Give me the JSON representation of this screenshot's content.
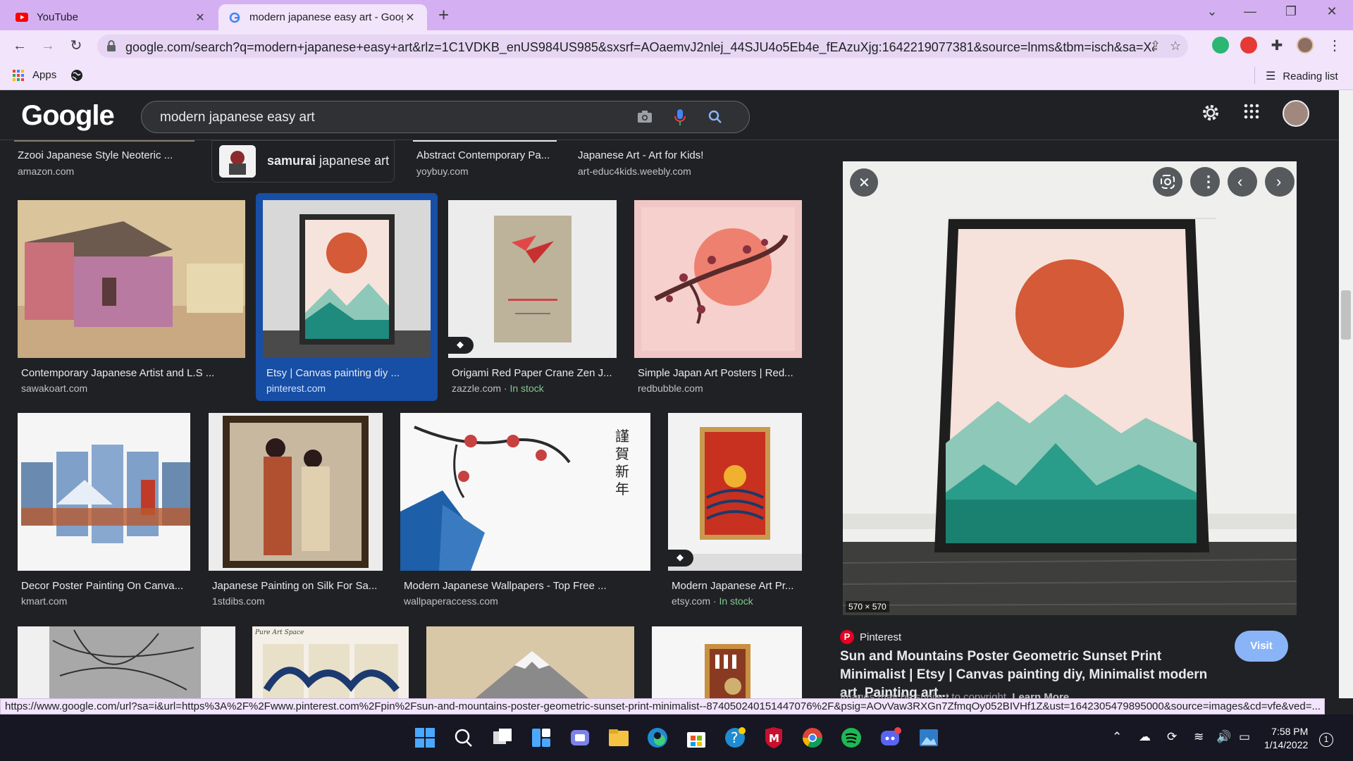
{
  "browser": {
    "tabs": [
      {
        "title": "YouTube",
        "icon": "youtube-icon"
      },
      {
        "title": "modern japanese easy art - Goog",
        "icon": "google-icon"
      }
    ],
    "url": "google.com/search?q=modern+japanese+easy+art&rlz=1C1VDKB_enUS984US985&sxsrf=AOaemvJ2nlej_44SJU4o5Eb4e_fEAzuXjg:1642219077381&source=lnms&tbm=isch&sa=X&ved...",
    "bookmarks": {
      "apps": "Apps",
      "reading_list": "Reading list"
    }
  },
  "google": {
    "logo": "Google",
    "query": "modern japanese easy art"
  },
  "results": {
    "row0": [
      {
        "caption": "Zzooi Japanese Style Neoteric ...",
        "domain": "amazon.com"
      },
      {
        "caption_bold": "samurai",
        "caption_rest": " japanese art"
      },
      {
        "caption": "Abstract Contemporary Pa...",
        "domain": "yoybuy.com"
      },
      {
        "caption": "Japanese Art - Art for Kids!",
        "domain": "art-educ4kids.weebly.com"
      }
    ],
    "row1": [
      {
        "caption": "Contemporary Japanese Artist and L.S ...",
        "domain": "sawakoart.com"
      },
      {
        "caption": "Etsy | Canvas painting diy ...",
        "domain": "pinterest.com"
      },
      {
        "caption": "Origami Red Paper Crane Zen J...",
        "domain": "zazzle.com",
        "stock": "In stock"
      },
      {
        "caption": "Simple Japan Art Posters | Red...",
        "domain": "redbubble.com"
      }
    ],
    "row2": [
      {
        "caption": "Decor Poster Painting On Canva...",
        "domain": "kmart.com"
      },
      {
        "caption": "Japanese Painting on Silk For Sa...",
        "domain": "1stdibs.com"
      },
      {
        "caption": "Modern Japanese Wallpapers - Top Free ...",
        "domain": "wallpaperaccess.com"
      },
      {
        "caption": "Modern Japanese Art Pr...",
        "domain": "etsy.com",
        "stock": "In stock"
      }
    ],
    "row3_thumb_text": "Pure Art Space",
    "separator": " · "
  },
  "preview": {
    "dims": "570 × 570",
    "source": "Pinterest",
    "title": "Sun and Mountains Poster Geometric Sunset Print Minimalist | Etsy | Canvas painting diy, Minimalist modern art, Painting art...",
    "visit": "Visit",
    "copyright": "Images may be subject to copyright.",
    "learn_more": "Learn More"
  },
  "status_url": "https://www.google.com/url?sa=i&url=https%3A%2F%2Fwww.pinterest.com%2Fpin%2Fsun-and-mountains-poster-geometric-sunset-print-minimalist--874050240151447076%2F&psig=AOvVaw3RXGn7ZfmqOy052BIVHf1Z&ust=1642305479895000&source=images&cd=vfe&ved=...",
  "taskbar": {
    "time": "7:58 PM",
    "date": "1/14/2022",
    "notifications": "1"
  },
  "colors": {
    "chrome_frame": "#d4b0f2",
    "chrome_toolbar": "#f1e4fb",
    "google_bg": "#202124",
    "selected": "#174ea6",
    "in_stock": "#81c995",
    "visit": "#8ab4f8",
    "sun": "#d45a38",
    "teal": "#1f8a7e"
  }
}
